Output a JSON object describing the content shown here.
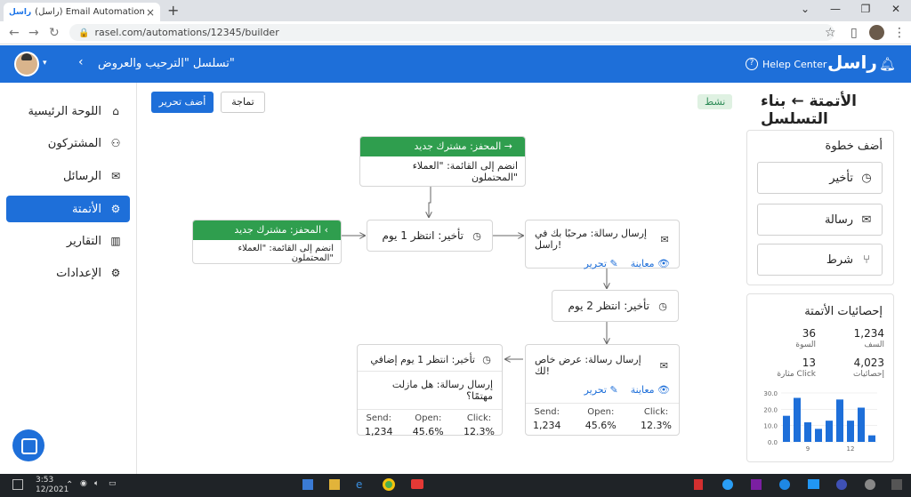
{
  "browser": {
    "tab_title": "(راسل) Email Automation System",
    "tab_favicon": "راسل",
    "url": "rasel.com/automations/12345/builder"
  },
  "header": {
    "brand": "راسل",
    "help": "Helep Center",
    "sequence_title": "تسلسل \"الترحيب والعروض\""
  },
  "sidebar": {
    "items": [
      {
        "label": "اللوحة الرئيسية",
        "icon": "home-icon",
        "glyph": "⌂"
      },
      {
        "label": "المشتركون",
        "icon": "users-icon",
        "glyph": "👥"
      },
      {
        "label": "الرسائل",
        "icon": "mail-icon",
        "glyph": "✉"
      },
      {
        "label": "الأتمتة",
        "icon": "gear-icon",
        "glyph": "⚙"
      },
      {
        "label": "التقارير",
        "icon": "chart-icon",
        "glyph": "▥"
      },
      {
        "label": "الإعدادات",
        "icon": "settings-icon",
        "glyph": "⚙"
      }
    ]
  },
  "page": {
    "title": "الأتمتة ← بناء التسلسل",
    "status": "نشط",
    "add_button": "أضف تحرير",
    "preview_button": "تماجة"
  },
  "flow": {
    "trigger1": {
      "head": "المحفز: مشترك جديد",
      "body": "انضم إلى القائمة: \"العملاء المحتملون\""
    },
    "trigger2": {
      "head": "المحفز: مشترك جديد",
      "body": "انضم إلى القائمة: \"العملاء المحتملون\""
    },
    "delay1": "تأخير: انتظر 1 يوم",
    "email1": {
      "title": "إرسال رسالة: مرحبًا بك في راسل!",
      "preview": "معاينة",
      "edit": "تحرير"
    },
    "delay2": "تأخير: انتظر 2 يوم",
    "email2": {
      "title": "إرسال رسالة: عرض خاص لك!",
      "preview": "معاينة",
      "edit": "تحرير",
      "stats": {
        "send_label": "Send:",
        "send": "1,234",
        "open_label": "Open:",
        "open": "45.6%",
        "click_label": "Click:",
        "click": "12.3%"
      }
    },
    "delay3": {
      "title": "تأخير: انتظر 1 يوم إضافي",
      "body": "إرسال رسالة: هل مازلت مهتمًا؟",
      "stats": {
        "send_label": "Send:",
        "send": "1,234",
        "open_label": "Open:",
        "open": "45.6%",
        "click_label": "Click:",
        "click": "12.3%"
      }
    }
  },
  "add_step": {
    "title": "أضف خطوة",
    "items": [
      {
        "label": "تأخير",
        "icon": "clock-icon"
      },
      {
        "label": "رسالة",
        "icon": "mail-icon"
      },
      {
        "label": "شرط",
        "icon": "branch-icon"
      }
    ]
  },
  "stats_panel": {
    "title": "إحصائيات الأتمتة",
    "kpis": [
      {
        "value": "1,234",
        "label": "السف"
      },
      {
        "value": "36",
        "label": "السوة"
      },
      {
        "value": "4,023",
        "label": "إحصائيات"
      },
      {
        "value": "13",
        "label": "مثارة Click"
      }
    ]
  },
  "chart_data": {
    "type": "bar",
    "values": [
      16,
      27,
      12,
      8,
      13,
      26,
      13,
      21,
      4
    ],
    "ylim": [
      0,
      30
    ],
    "yticks": [
      "30.0",
      "20.0",
      "10.0",
      "0.0"
    ],
    "xticks": [
      "9",
      "12"
    ],
    "color": "#1e6fd9"
  },
  "taskbar": {
    "time": "3:53",
    "date": "12/2021"
  }
}
